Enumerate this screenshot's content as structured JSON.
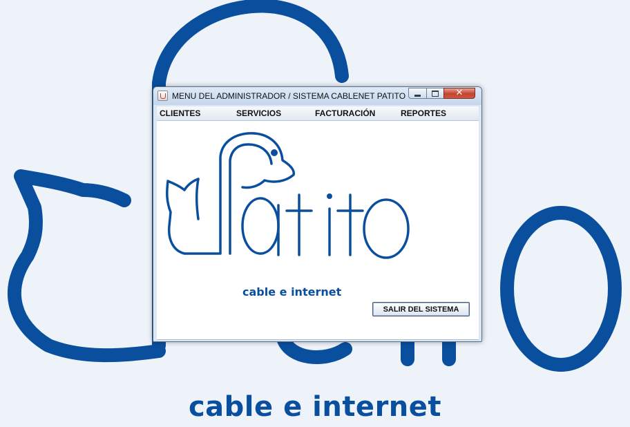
{
  "background": {
    "tagline": "cable e internet"
  },
  "window": {
    "title": "MENU DEL ADMINISTRADOR / SISTEMA CABLENET PATITO",
    "controls": {
      "close_glyph": "✕"
    },
    "menu": [
      {
        "label": "CLIENTES"
      },
      {
        "label": "SERVICIOS"
      },
      {
        "label": "FACTURACIÓN"
      },
      {
        "label": "REPORTES"
      }
    ],
    "content": {
      "tagline": "cable e internet",
      "exit_button_label": "SALIR DEL SISTEMA"
    }
  },
  "colors": {
    "brand_blue": "#0a4f9e",
    "desktop_bg": "#eef3fa"
  },
  "icons": [
    "java-app-icon",
    "minimize-icon",
    "maximize-icon",
    "close-icon",
    "patito-duck-cat-logo"
  ]
}
